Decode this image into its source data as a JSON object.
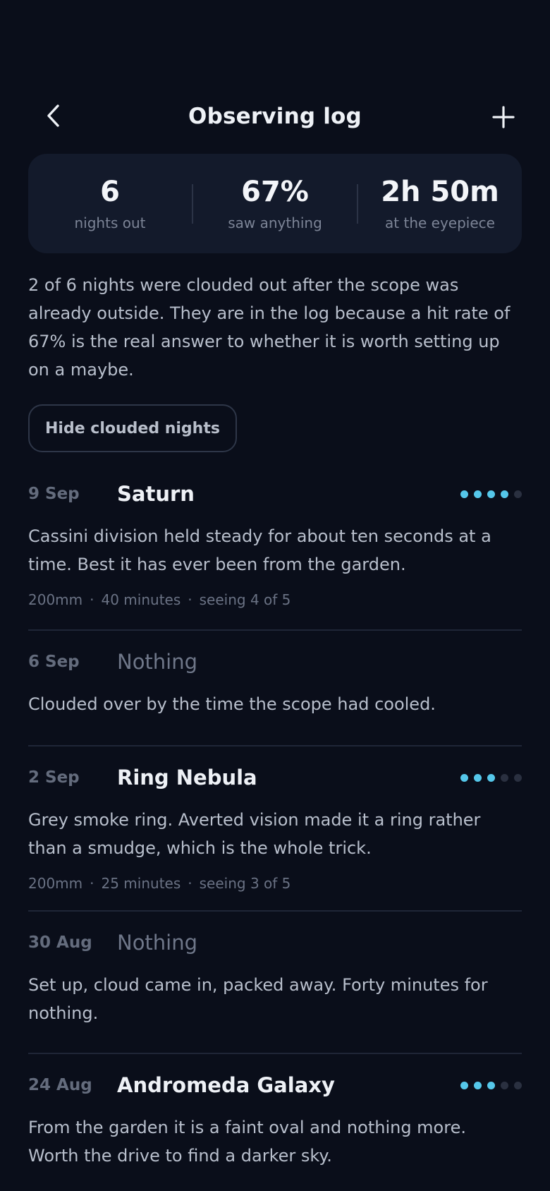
{
  "header": {
    "title": "Observing log",
    "back_icon": "chevron-left-icon",
    "add_icon": "plus-icon"
  },
  "stats": [
    {
      "value": "6",
      "label": "nights out"
    },
    {
      "value": "67%",
      "label": "saw anything"
    },
    {
      "value": "2h 50m",
      "label": "at the eyepiece"
    }
  ],
  "intro": "2 of 6 nights were clouded out after the scope was already outside. They are in the log because a hit rate of 67% is the real answer to whether it is worth setting up on a maybe.",
  "filter": {
    "label": "Hide clouded nights"
  },
  "colors": {
    "accent": "#55c7ea",
    "background": "#0a0e1a",
    "card": "#131a2b"
  },
  "entries": [
    {
      "date": "9 Sep",
      "target": "Saturn",
      "nothing": false,
      "rating": 4,
      "rating_max": 5,
      "note": "Cassini division held steady for about ten seconds at a time. Best it has ever been from the garden.",
      "meta": {
        "aperture": "200mm",
        "duration": "40 minutes",
        "seeing": "seeing 4 of 5"
      }
    },
    {
      "date": "6 Sep",
      "target": "Nothing",
      "nothing": true,
      "note": "Clouded over by the time the scope had cooled."
    },
    {
      "date": "2 Sep",
      "target": "Ring Nebula",
      "nothing": false,
      "rating": 3,
      "rating_max": 5,
      "note": "Grey smoke ring. Averted vision made it a ring rather than a smudge, which is the whole trick.",
      "meta": {
        "aperture": "200mm",
        "duration": "25 minutes",
        "seeing": "seeing 3 of 5"
      }
    },
    {
      "date": "30 Aug",
      "target": "Nothing",
      "nothing": true,
      "note": "Set up, cloud came in, packed away. Forty minutes for nothing."
    },
    {
      "date": "24 Aug",
      "target": "Andromeda Galaxy",
      "nothing": false,
      "rating": 3,
      "rating_max": 5,
      "note": "From the garden it is a faint oval and nothing more. Worth the drive to find a darker sky."
    }
  ]
}
